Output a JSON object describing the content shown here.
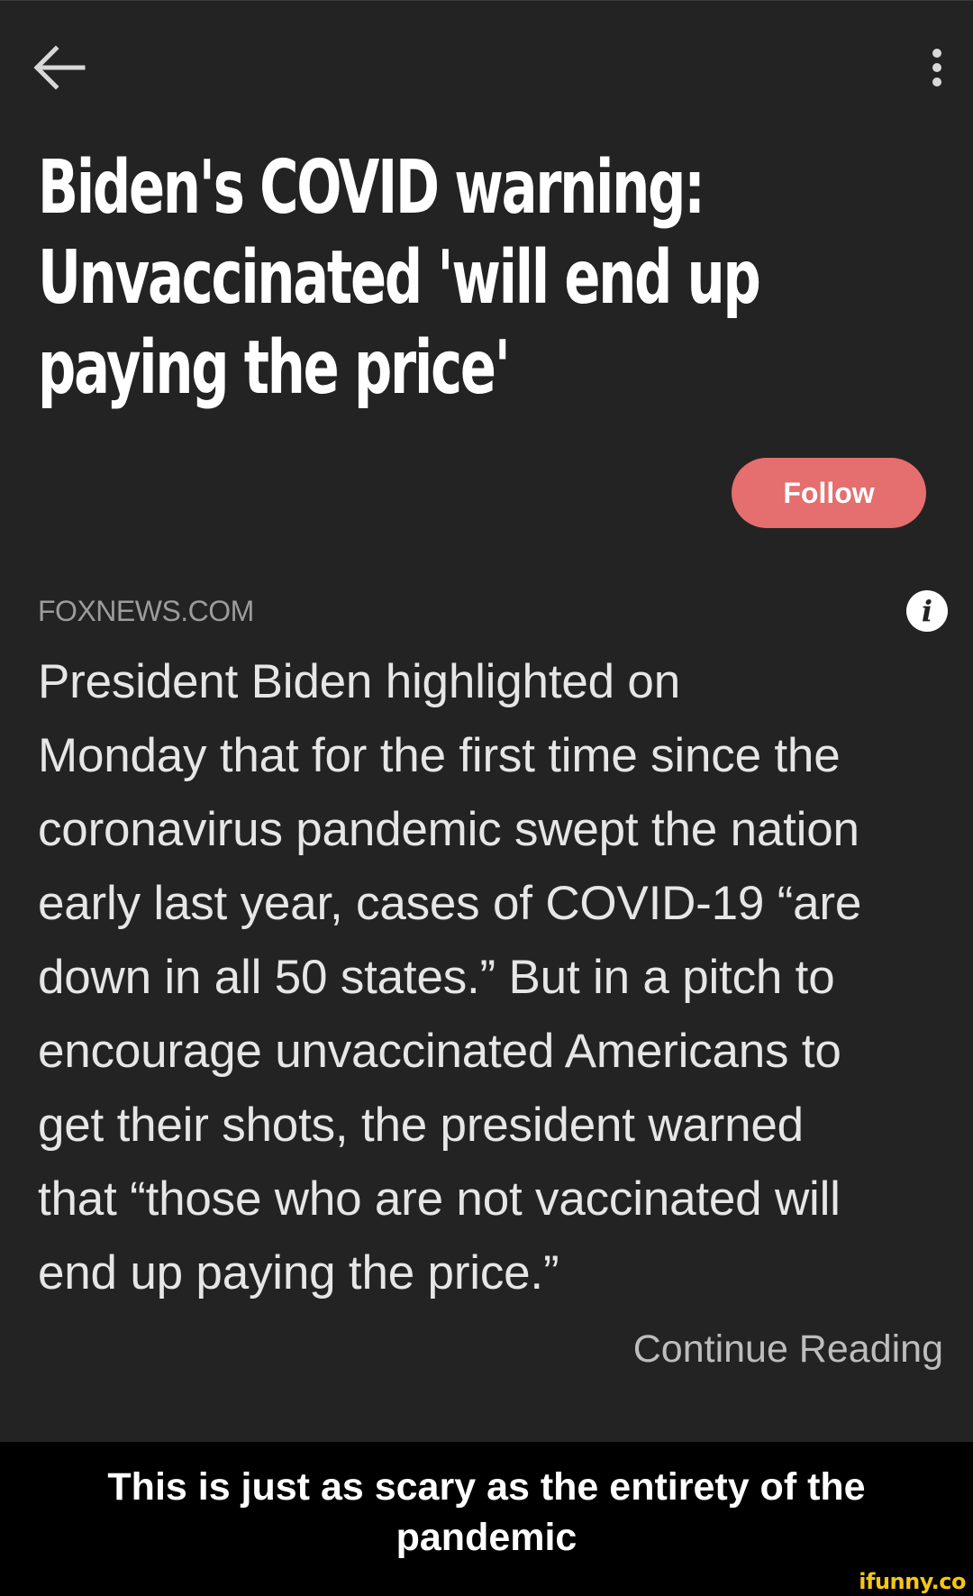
{
  "icons": {
    "back": "arrow-left-icon",
    "menu": "more-vertical-icon",
    "info": "info-icon"
  },
  "article": {
    "headline_lines": [
      "Biden's COVID warning:",
      "Unvaccinated 'will end up",
      "paying the price'"
    ],
    "follow_label": "Follow",
    "source": "FOXNEWS.COM",
    "info_glyph": "i",
    "body_lines": [
      "President Biden highlighted on",
      "Monday that for the first time since the",
      "coronavirus pandemic swept the nation",
      "early last year, cases of COVID-19 “are",
      "down in all 50 states.” But in a pitch to",
      "encourage unvaccinated Americans to",
      "get their shots, the president warned",
      "that “those who are not vaccinated will",
      "end up paying the price.”"
    ],
    "continue_label": "Continue Reading"
  },
  "caption": {
    "lines": [
      "This is just as scary as the entirety of the",
      "pandemic"
    ]
  },
  "watermark": "ifunny.co",
  "colors": {
    "background": "#232323",
    "follow_button": "#e56e6e",
    "caption_background": "#000000",
    "watermark": "#f5c518"
  }
}
